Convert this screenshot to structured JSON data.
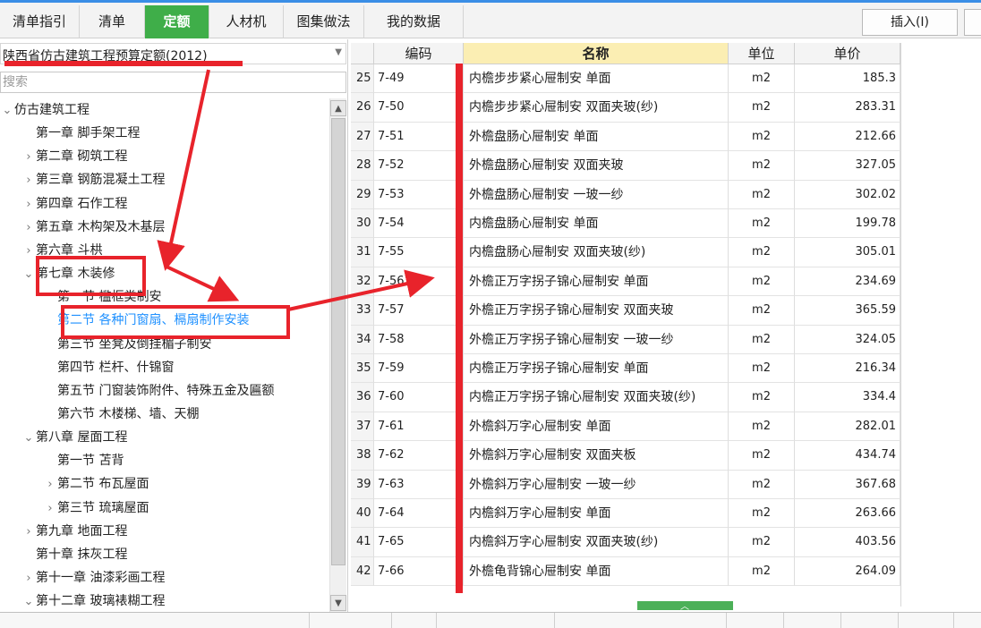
{
  "tabs": [
    {
      "label": "清单指引",
      "active": false
    },
    {
      "label": "清单",
      "active": false
    },
    {
      "label": "定额",
      "active": true
    },
    {
      "label": "人材机",
      "active": false
    },
    {
      "label": "图集做法",
      "active": false
    },
    {
      "label": "我的数据",
      "active": false
    }
  ],
  "toolbar": {
    "insert_label": "插入(I)"
  },
  "quota_book": {
    "selected": "陕西省仿古建筑工程预算定额(2012)"
  },
  "search": {
    "placeholder": "搜索"
  },
  "tree": [
    {
      "label": "仿古建筑工程",
      "toggle": "expanded"
    },
    {
      "label": "第一章 脚手架工程",
      "toggle": "none"
    },
    {
      "label": "第二章 砌筑工程",
      "toggle": "collapsed"
    },
    {
      "label": "第三章 钢筋混凝土工程",
      "toggle": "collapsed"
    },
    {
      "label": "第四章 石作工程",
      "toggle": "collapsed"
    },
    {
      "label": "第五章 木构架及木基层",
      "toggle": "collapsed"
    },
    {
      "label": "第六章 斗栱",
      "toggle": "collapsed"
    },
    {
      "label": "第七章 木装修",
      "toggle": "expanded"
    },
    {
      "label": "第一节 槛框类制安",
      "toggle": "none"
    },
    {
      "label": "第二节 各种门窗扇、槅扇制作安装",
      "toggle": "none",
      "selected": true
    },
    {
      "label": "第三节 坐凳及倒挂楣子制安",
      "toggle": "none"
    },
    {
      "label": "第四节 栏杆、什锦窗",
      "toggle": "none"
    },
    {
      "label": "第五节 门窗装饰附件、特殊五金及匾额",
      "toggle": "none"
    },
    {
      "label": "第六节 木楼梯、墙、天棚",
      "toggle": "none"
    },
    {
      "label": "第八章 屋面工程",
      "toggle": "expanded"
    },
    {
      "label": "第一节 苫背",
      "toggle": "none"
    },
    {
      "label": "第二节 布瓦屋面",
      "toggle": "collapsed"
    },
    {
      "label": "第三节 琉璃屋面",
      "toggle": "collapsed"
    },
    {
      "label": "第九章 地面工程",
      "toggle": "collapsed"
    },
    {
      "label": "第十章 抹灰工程",
      "toggle": "none"
    },
    {
      "label": "第十一章 油漆彩画工程",
      "toggle": "collapsed"
    },
    {
      "label": "第十二章 玻璃裱糊工程",
      "toggle": "expanded"
    }
  ],
  "grid": {
    "headers": {
      "code": "编码",
      "name": "名称",
      "unit": "单位",
      "price": "单价"
    },
    "rows": [
      {
        "idx": "25",
        "code": "7-49",
        "name": "内檐步步紧心屉制安 单面",
        "unit": "m2",
        "price": "185.3"
      },
      {
        "idx": "26",
        "code": "7-50",
        "name": "内檐步步紧心屉制安 双面夹玻(纱)",
        "unit": "m2",
        "price": "283.31"
      },
      {
        "idx": "27",
        "code": "7-51",
        "name": "外檐盘肠心屉制安 单面",
        "unit": "m2",
        "price": "212.66"
      },
      {
        "idx": "28",
        "code": "7-52",
        "name": "外檐盘肠心屉制安 双面夹玻",
        "unit": "m2",
        "price": "327.05"
      },
      {
        "idx": "29",
        "code": "7-53",
        "name": "外檐盘肠心屉制安 一玻一纱",
        "unit": "m2",
        "price": "302.02"
      },
      {
        "idx": "30",
        "code": "7-54",
        "name": "内檐盘肠心屉制安 单面",
        "unit": "m2",
        "price": "199.78"
      },
      {
        "idx": "31",
        "code": "7-55",
        "name": "内檐盘肠心屉制安 双面夹玻(纱)",
        "unit": "m2",
        "price": "305.01"
      },
      {
        "idx": "32",
        "code": "7-56",
        "name": "外檐正万字拐子锦心屉制安 单面",
        "unit": "m2",
        "price": "234.69"
      },
      {
        "idx": "33",
        "code": "7-57",
        "name": "外檐正万字拐子锦心屉制安 双面夹玻",
        "unit": "m2",
        "price": "365.59"
      },
      {
        "idx": "34",
        "code": "7-58",
        "name": "外檐正万字拐子锦心屉制安 一玻一纱",
        "unit": "m2",
        "price": "324.05"
      },
      {
        "idx": "35",
        "code": "7-59",
        "name": "内檐正万字拐子锦心屉制安 单面",
        "unit": "m2",
        "price": "216.34"
      },
      {
        "idx": "36",
        "code": "7-60",
        "name": "内檐正万字拐子锦心屉制安 双面夹玻(纱)",
        "unit": "m2",
        "price": "334.4"
      },
      {
        "idx": "37",
        "code": "7-61",
        "name": "外檐斜万字心屉制安 单面",
        "unit": "m2",
        "price": "282.01"
      },
      {
        "idx": "38",
        "code": "7-62",
        "name": "外檐斜万字心屉制安 双面夹板",
        "unit": "m2",
        "price": "434.74"
      },
      {
        "idx": "39",
        "code": "7-63",
        "name": "外檐斜万字心屉制安 一玻一纱",
        "unit": "m2",
        "price": "367.68"
      },
      {
        "idx": "40",
        "code": "7-64",
        "name": "内檐斜万字心屉制安 单面",
        "unit": "m2",
        "price": "263.66"
      },
      {
        "idx": "41",
        "code": "7-65",
        "name": "内檐斜万字心屉制安 双面夹玻(纱)",
        "unit": "m2",
        "price": "403.56"
      },
      {
        "idx": "42",
        "code": "7-66",
        "name": "外檐龟背锦心屉制安 单面",
        "unit": "m2",
        "price": "264.09"
      }
    ]
  },
  "colors": {
    "accent_green": "#3fae49",
    "selected_blue": "#1e90ff",
    "annotation_red": "#e8232b",
    "name_header": "#fbeeb3"
  }
}
